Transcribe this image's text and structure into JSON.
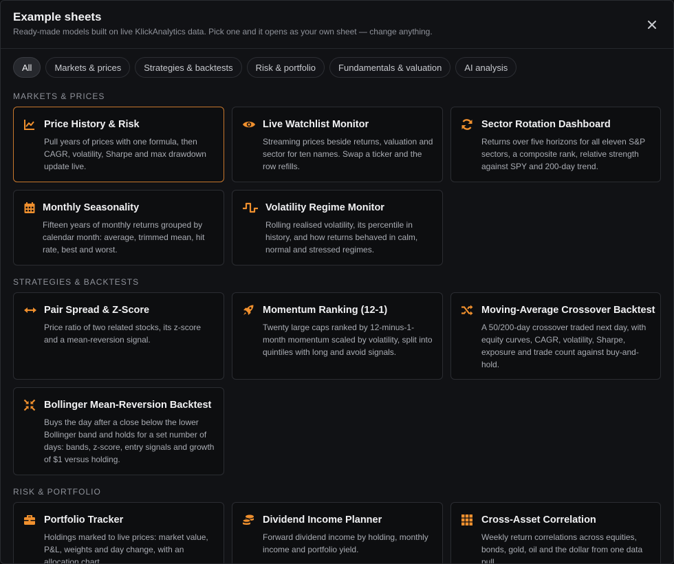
{
  "header": {
    "title": "Example sheets",
    "subtitle": "Ready-made models built on live KlickAnalytics data. Pick one and it opens as your own sheet — change anything."
  },
  "filters": [
    "All",
    "Markets & prices",
    "Strategies & backtests",
    "Risk & portfolio",
    "Fundamentals & valuation",
    "AI analysis"
  ],
  "active_filter": "All",
  "accent_color": "#f0902e",
  "sections": [
    {
      "label": "MARKETS & PRICES",
      "cards": [
        {
          "title": "Price History & Risk",
          "desc": "Pull years of prices with one formula, then CAGR, volatility, Sharpe and max drawdown update live.",
          "icon": "chart-line-icon",
          "selected": true
        },
        {
          "title": "Live Watchlist Monitor",
          "desc": "Streaming prices beside returns, valuation and sector for ten names. Swap a ticker and the row refills.",
          "icon": "eye-icon"
        },
        {
          "title": "Sector Rotation Dashboard",
          "desc": "Returns over five horizons for all eleven S&P sectors, a composite rank, relative strength against SPY and 200-day trend.",
          "icon": "rotate-icon"
        },
        {
          "title": "Monthly Seasonality",
          "desc": "Fifteen years of monthly returns grouped by calendar month: average, trimmed mean, hit rate, best and worst.",
          "icon": "calendar-icon"
        },
        {
          "title": "Volatility Regime Monitor",
          "desc": "Rolling realised volatility, its percentile in history, and how returns behaved in calm, normal and stressed regimes.",
          "icon": "square-wave-icon"
        }
      ]
    },
    {
      "label": "STRATEGIES & BACKTESTS",
      "cards": [
        {
          "title": "Pair Spread & Z-Score",
          "desc": "Price ratio of two related stocks, its z-score and a mean-reversion signal.",
          "icon": "arrows-horizontal-icon"
        },
        {
          "title": "Momentum Ranking (12-1)",
          "desc": "Twenty large caps ranked by 12-minus-1-month momentum scaled by volatility, split into quintiles with long and avoid signals.",
          "icon": "rocket-icon"
        },
        {
          "title": "Moving-Average Crossover Backtest",
          "desc": "A 50/200-day crossover traded next day, with equity curves, CAGR, volatility, Sharpe, exposure and trade count against buy-and-hold.",
          "icon": "shuffle-icon"
        },
        {
          "title": "Bollinger Mean-Reversion Backtest",
          "desc": "Buys the day after a close below the lower Bollinger band and holds for a set number of days: bands, z-score, entry signals and growth of $1 versus holding.",
          "icon": "compress-icon"
        }
      ]
    },
    {
      "label": "RISK & PORTFOLIO",
      "cards": [
        {
          "title": "Portfolio Tracker",
          "desc": "Holdings marked to live prices: market value, P&L, weights and day change, with an allocation chart.",
          "icon": "briefcase-icon"
        },
        {
          "title": "Dividend Income Planner",
          "desc": "Forward dividend income by holding, monthly income and portfolio yield.",
          "icon": "coins-icon"
        },
        {
          "title": "Cross-Asset Correlation",
          "desc": "Weekly return correlations across equities, bonds, gold, oil and the dollar from one data pull.",
          "icon": "grid-icon"
        }
      ]
    }
  ]
}
